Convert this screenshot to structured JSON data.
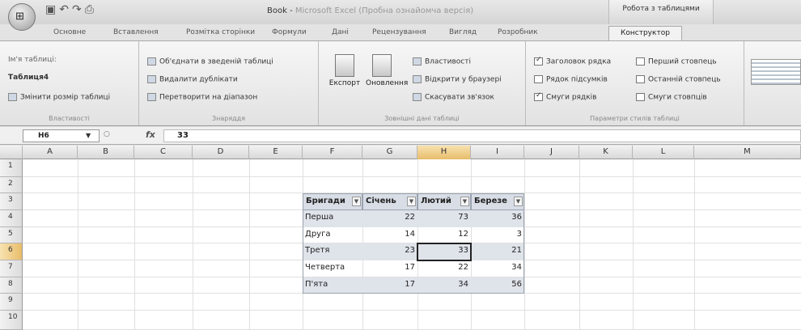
{
  "window": {
    "title": "Book - Microsoft Excel (Пробна ознайомча версія)",
    "title_main": "Book - ",
    "title_dim": "Microsoft Excel (Пробна ознайомча версія)",
    "context_title": "Робота з таблицями",
    "qat_icons": [
      "save-icon",
      "undo-icon",
      "redo-icon",
      "print-icon"
    ]
  },
  "tabs": [
    "Основне",
    "Вставлення",
    "Розмітка сторінки",
    "Формули",
    "Дані",
    "Рецензування",
    "Вигляд",
    "Розробник",
    "Конструктор"
  ],
  "ribbon": {
    "properties": {
      "label": "Властивості",
      "name_label": "Ім'я таблиці:",
      "name_value": "Таблиця4",
      "resize": "Змінити розмір таблиці"
    },
    "tools": {
      "label": "Знаряддя",
      "summarize": "Об'єднати в зведеній таблиці",
      "remove_dup": "Видалити дублікати",
      "convert": "Перетворити на діапазон"
    },
    "external": {
      "label": "Зовнішні дані таблиці",
      "export": "Експорт",
      "refresh": "Оновлення",
      "props": "Властивості",
      "open_browser": "Відкрити у браузері",
      "unlink": "Скасувати зв'язок"
    },
    "style_options": {
      "label": "Параметри стилів таблиці",
      "header_row": "Заголовок рядка",
      "total_row": "Рядок підсумків",
      "banded_rows": "Смуги рядків",
      "first_col": "Перший стовпець",
      "last_col": "Останній стовпець",
      "banded_cols": "Смуги стовпців"
    }
  },
  "formula_bar": {
    "name_box": "H6",
    "fx": "fx",
    "value": "33"
  },
  "sheet": {
    "columns": [
      "A",
      "B",
      "C",
      "D",
      "E",
      "F",
      "G",
      "H",
      "I",
      "J",
      "K",
      "L",
      "M"
    ],
    "rows": [
      "1",
      "2",
      "3",
      "4",
      "5",
      "6",
      "7",
      "8",
      "9",
      "10"
    ],
    "selected_column": "H",
    "selected_row": "6",
    "table": {
      "headers": [
        "Бригади",
        "Січень",
        "Лютий",
        "Березень"
      ],
      "header_display": [
        "Бригади",
        "Січень",
        "Лютий",
        "Березе"
      ],
      "rows": [
        [
          "Перша",
          "22",
          "73",
          "36"
        ],
        [
          "Друга",
          "14",
          "12",
          "3"
        ],
        [
          "Третя",
          "23",
          "33",
          "21"
        ],
        [
          "Четверта",
          "17",
          "22",
          "34"
        ],
        [
          "П'ята",
          "17",
          "34",
          "56"
        ]
      ]
    }
  }
}
